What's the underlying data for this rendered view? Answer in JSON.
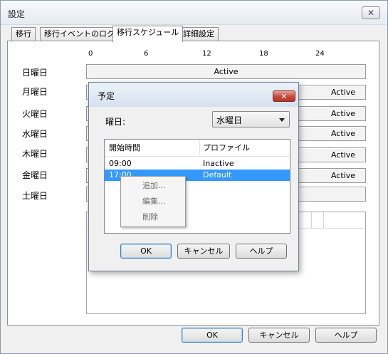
{
  "window": {
    "title": "設定",
    "close_glyph": "✕"
  },
  "tabs": [
    {
      "label": "移行",
      "active": false
    },
    {
      "label": "移行イベントのログ",
      "active": false
    },
    {
      "label": "移行スケジュール",
      "active": true
    },
    {
      "label": "詳細設定",
      "active": false
    }
  ],
  "schedule": {
    "hour_ticks": [
      "0",
      "6",
      "12",
      "18",
      "24"
    ],
    "days": [
      {
        "label": "日曜日",
        "status": "Active"
      },
      {
        "label": "月曜日",
        "status": "Active"
      },
      {
        "label": "火曜日",
        "status": "Active"
      },
      {
        "label": "水曜日",
        "status": "Active"
      },
      {
        "label": "木曜日",
        "status": "Active"
      },
      {
        "label": "金曜日",
        "status": "Active"
      },
      {
        "label": "土曜日",
        "status": ""
      }
    ]
  },
  "footer": {
    "ok": "OK",
    "cancel": "キャンセル",
    "help": "ヘルプ"
  },
  "dialog": {
    "title": "予定",
    "close_glyph": "✕",
    "weekday_label": "曜日:",
    "weekday_value": "水曜日",
    "columns": {
      "start_time": "開始時間",
      "profile": "プロファイル"
    },
    "rows": [
      {
        "time": "09:00",
        "profile": "Inactive",
        "selected": false
      },
      {
        "time": "17:00",
        "profile": "Default",
        "selected": true
      }
    ],
    "context_menu": [
      "追加...",
      "編集...",
      "削除"
    ],
    "buttons": {
      "ok": "OK",
      "cancel": "キャンセル",
      "help": "ヘルプ"
    }
  },
  "colors": {
    "selection": "#3399ff",
    "close_button": "#c9483a",
    "dialog_title": "#d6e1ee"
  }
}
